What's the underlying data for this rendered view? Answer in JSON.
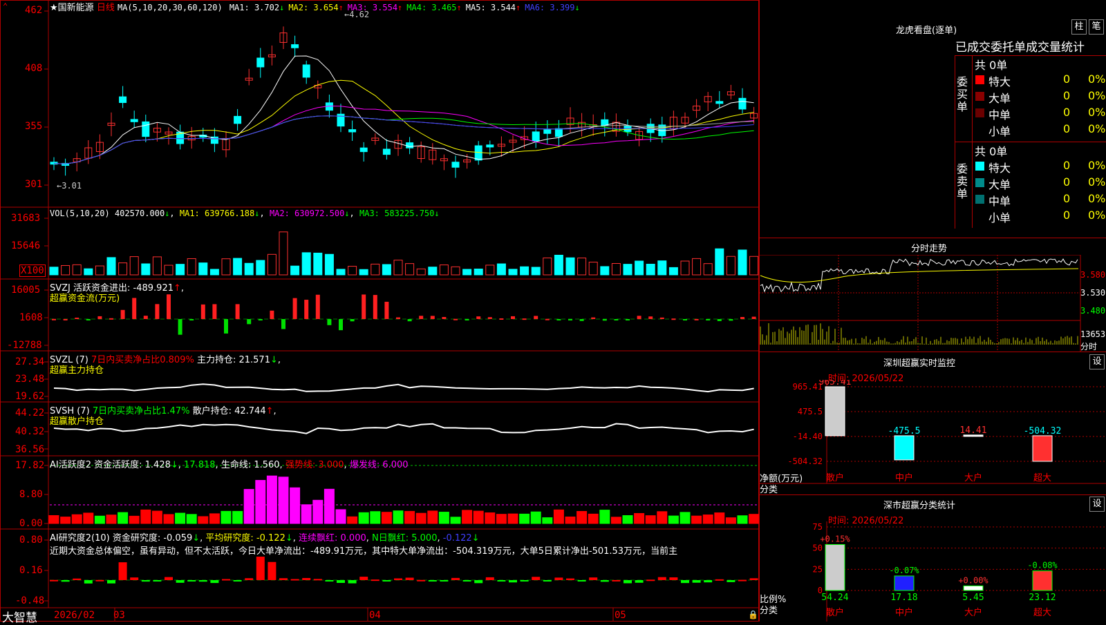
{
  "stock": {
    "name": "国新能源",
    "period": "日线",
    "ma_label": "MA(5,10,20,30,60,120)"
  },
  "ma_values": [
    {
      "label": "MA1:",
      "value": "3.702",
      "arrow": "↓",
      "color": "#ffffff"
    },
    {
      "label": "MA2:",
      "value": "3.654",
      "arrow": "↑",
      "color": "#ffff00"
    },
    {
      "label": "MA3:",
      "value": "3.554",
      "arrow": "↑",
      "color": "#ff00ff"
    },
    {
      "label": "MA4:",
      "value": "3.465",
      "arrow": "↑",
      "color": "#00ff00"
    },
    {
      "label": "MA5:",
      "value": "3.544",
      "arrow": "↑",
      "color": "#ffffff"
    },
    {
      "label": "MA6:",
      "value": "3.399",
      "arrow": "↓",
      "color": "#4040ff"
    }
  ],
  "price_axis": [
    "462",
    "408",
    "355",
    "301"
  ],
  "price_marks": {
    "high": "4.62",
    "low": "3.01"
  },
  "vol": {
    "header": "VOL(5,10,20)",
    "value": "402570.000",
    "ma1": "MA1: 639766.188",
    "ma2": "MA2: 630972.500",
    "ma3": "MA3: 583225.750",
    "axis": [
      "31683",
      "15646",
      "X100"
    ]
  },
  "svzj": {
    "header": "SVZJ  活跃资金进出:",
    "value": "-489.921",
    "sub": "超赢资金流(万元)",
    "axis": [
      "16005",
      "1608",
      "-12788"
    ]
  },
  "svzl": {
    "header": "SVZL (7)",
    "pct": "7日内买卖净占比0.809%",
    "hold": "主力持仓: 21.571",
    "sub": "超赢主力持仓",
    "axis": [
      "27.34",
      "23.48",
      "19.62"
    ]
  },
  "svsh": {
    "header": "SVSH (7)",
    "pct": "7日内买卖净占比1.47%",
    "hold": "散户持仓: 42.744",
    "sub": "超赢散户持仓",
    "axis": [
      "44.22",
      "40.32",
      "36.56"
    ]
  },
  "ai2": {
    "header": "AI活跃度2",
    "t1": "资金活跃度: 1.428",
    "t2": "17.818",
    "t3": "生命线: 1.560",
    "t4": "强势线: 3.000",
    "t5": "爆发线: 6.000",
    "axis": [
      "17.82",
      "8.80",
      "0.00"
    ]
  },
  "ai_res": {
    "header": "AI研究度2(10)",
    "t1": "资金研究度: -0.059",
    "t2": "平均研究度: -0.122",
    "t3": "连续飘红: 0.000",
    "t4": "N日飘红: 5.000",
    "t5": "-0.122",
    "axis": [
      "0.80",
      "0.16",
      "-0.48"
    ]
  },
  "commentary": "近期大资金总体偏空，虽有异动，但不太活跃，今日大单净流出：-489.91万元，其中特大单净流出：-504.319万元，大单5日累计净出-501.53万元，当前主",
  "bottom": {
    "brand": "大智慧",
    "dates": [
      "2026/02",
      "03",
      "04",
      "05"
    ]
  },
  "right": {
    "dragon_title": "龙虎看盘(逐单)",
    "btn_zhu": "柱",
    "btn_bi": "笔",
    "order_stats_title": "已成交委托单成交量统计",
    "buy_label": "委买单",
    "sell_label": "委卖单",
    "buy_total": "共 0单",
    "sell_total": "共 0单",
    "buy_rows": [
      {
        "name": "特大",
        "count": "0",
        "pct": "0%",
        "color": "#ff0000"
      },
      {
        "name": "大单",
        "count": "0",
        "pct": "0%",
        "color": "#8b0000"
      },
      {
        "name": "中单",
        "count": "0",
        "pct": "0%",
        "color": "#6b0000"
      },
      {
        "name": "小单",
        "count": "0",
        "pct": "0%",
        "color": "#000000"
      }
    ],
    "sell_rows": [
      {
        "name": "特大",
        "count": "0",
        "pct": "0%",
        "color": "#00ffff"
      },
      {
        "name": "大单",
        "count": "0",
        "pct": "0%",
        "color": "#008b8b"
      },
      {
        "name": "中单",
        "count": "0",
        "pct": "0%",
        "color": "#007070"
      },
      {
        "name": "小单",
        "count": "0",
        "pct": "0%",
        "color": "#000000"
      }
    ],
    "intraday_title": "分时走势",
    "intraday_axis": [
      "3.580",
      "3.530",
      "3.480",
      "13653",
      "分时"
    ],
    "monitor_title": "深圳超赢实时监控",
    "monitor_btn": "设",
    "monitor_time": "时间: 2026/05/22",
    "monitor_axis": [
      "965.41",
      "475.5",
      "-14.40",
      "-504.32"
    ],
    "monitor_ylabel": "净额(万元)",
    "monitor_xlabel": "分类",
    "class_title": "深市超赢分类统计",
    "class_btn": "设",
    "class_time": "时间: 2026/05/22",
    "class_axis": [
      "75",
      "50",
      "25",
      "0"
    ],
    "class_ylabel": "比例%",
    "class_xlabel": "分类"
  },
  "chart_data": [
    {
      "type": "bar",
      "title": "深圳超赢实时监控",
      "ylabel": "净额(万元)",
      "xlabel": "分类",
      "categories": [
        "散户",
        "中户",
        "大户",
        "超大"
      ],
      "values": [
        965.41,
        -475.5,
        14.41,
        -504.32
      ],
      "ylim": [
        -504.32,
        965.41
      ]
    },
    {
      "type": "bar",
      "title": "深市超赢分类统计",
      "ylabel": "比例%",
      "xlabel": "分类",
      "categories": [
        "散户",
        "中户",
        "大户",
        "超大"
      ],
      "values": [
        54.24,
        17.18,
        5.45,
        23.12
      ],
      "changes": [
        "+0.15%",
        "-0.07%",
        "+0.00%",
        "-0.08%"
      ],
      "ylim": [
        0,
        75
      ]
    }
  ]
}
